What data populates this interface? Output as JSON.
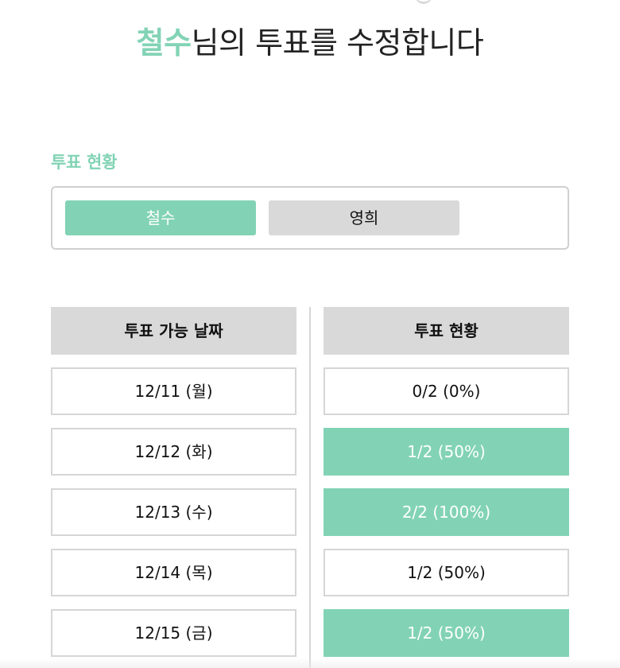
{
  "header": {
    "user_name": "철수",
    "title_suffix": "님의 투표를 수정합니다"
  },
  "voters": {
    "section_label": "투표 현황",
    "items": [
      {
        "name": "철수",
        "active": true
      },
      {
        "name": "영희",
        "active": false
      }
    ]
  },
  "table": {
    "date_header": "투표 가능 날짜",
    "status_header": "투표 현황",
    "rows": [
      {
        "date": "12/11 (월)",
        "status": "0/2 (0%)",
        "highlighted": false
      },
      {
        "date": "12/12 (화)",
        "status": "1/2 (50%)",
        "highlighted": true
      },
      {
        "date": "12/13 (수)",
        "status": "2/2 (100%)",
        "highlighted": true
      },
      {
        "date": "12/14 (목)",
        "status": "1/2 (50%)",
        "highlighted": false
      },
      {
        "date": "12/15 (금)",
        "status": "1/2 (50%)",
        "highlighted": true
      }
    ]
  },
  "colors": {
    "accent": "#82d3b5",
    "neutral": "#d9d9d9",
    "border": "#d6d6d6"
  }
}
